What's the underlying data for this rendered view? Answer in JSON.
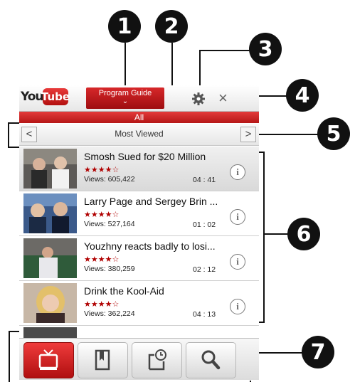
{
  "callouts": [
    "1",
    "2",
    "3",
    "4",
    "5",
    "6",
    "7"
  ],
  "header": {
    "logo_you": "You",
    "logo_tube": "Tube",
    "program_guide_label": "Program Guide",
    "program_guide_chevron": "⌄",
    "settings_icon": "gear-icon",
    "close_label": "×"
  },
  "filter": {
    "label": "All"
  },
  "category": {
    "prev": "<",
    "label": "Most Viewed",
    "next": ">"
  },
  "videos": [
    {
      "title": "Smosh Sued for $20 Million",
      "stars": "★★★★☆",
      "views": "Views: 605,422",
      "duration": "04 : 41"
    },
    {
      "title": "Larry Page and Sergey Brin ...",
      "stars": "★★★★☆",
      "views": "Views: 527,164",
      "duration": "01 : 02"
    },
    {
      "title": "Youzhny reacts badly to losi...",
      "stars": "★★★★☆",
      "views": "Views: 380,259",
      "duration": "02 : 12"
    },
    {
      "title": "Drink the Kool-Aid",
      "stars": "★★★★☆",
      "views": "Views: 362,224",
      "duration": "04 : 13"
    }
  ],
  "info_glyph": "i",
  "tabs": [
    "tv-icon",
    "bookmark-icon",
    "history-icon",
    "search-icon"
  ],
  "colors": {
    "accent": "#c4161a",
    "callout": "#111111"
  }
}
